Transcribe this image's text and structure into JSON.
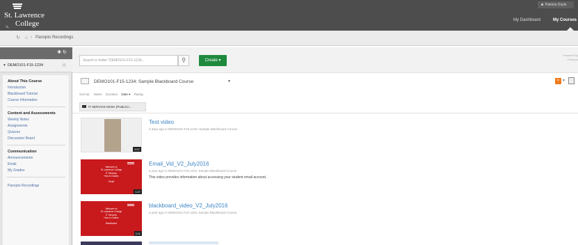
{
  "header": {
    "logo_line1": "St. Lawrence",
    "logo_line2": "College",
    "user_name": "Patricia Doyle",
    "nav": {
      "dashboard": "My Dashboard",
      "courses": "My Courses"
    }
  },
  "breadcrumb": {
    "label": "Panopto Recordings"
  },
  "sidebar": {
    "course_title": "DEMO101-F15-1234",
    "sections": [
      {
        "heading": "About This Course",
        "links": [
          "Introduction",
          "Blackboard Tutorial",
          "Course Information"
        ]
      },
      {
        "heading": "Content and Assessments",
        "links": [
          "Weekly Notes",
          "Assignments",
          "Quizzes",
          "Discussion Board"
        ]
      },
      {
        "heading": "Communication",
        "links": [
          "Announcements",
          "Email",
          "My Grades"
        ]
      }
    ],
    "extra_link": "Panopto Recordings"
  },
  "toolbar": {
    "search_placeholder": "Search in folder \"DEMO101-F15-1234...",
    "create_label": "Create ▾",
    "powered_by_line1": "Powered By",
    "powered_by_line2": "Panopto"
  },
  "folder": {
    "title": "DEMO101-F15-1234: Sample Blackboard Course",
    "sort_label": "Sort by:",
    "sort_options": [
      "Name",
      "Duration",
      "Date ▾",
      "Rating"
    ],
    "subfolder_label": "IT SERVICE DESK (PUBLICI..."
  },
  "sessions": [
    {
      "title": "Test video",
      "meta": "3 days ago in DEMO101-F15-1234: Sample Blackboard Course",
      "description": "",
      "duration": "0:07"
    },
    {
      "title": "Email_Vid_V2_July2016",
      "meta": "a year ago in DEMO101-F15-1234: Sample Blackboard Course",
      "description": "This video provides information about accessing your student email account.",
      "duration": "1:27",
      "thumb_lines": [
        "Welcome to",
        "St. Lawrence College",
        "IT Services",
        "How to Guides",
        "",
        "Email"
      ]
    },
    {
      "title": "blackboard_video_V2_July2016",
      "meta": "a year ago in DEMO101-F15-1234: Sample Blackboard Course",
      "description": "",
      "duration": "3:11",
      "thumb_lines": [
        "Welcome to",
        "St. Lawrence College",
        "IT Services",
        "How to Guides",
        "",
        "Blackboard"
      ]
    }
  ],
  "colors": {
    "topbar": "#4d4d4d",
    "create_button": "#1f8a3d",
    "link": "#3c85c4",
    "thumb_red": "#c8191c",
    "rss": "#f07b1c"
  }
}
